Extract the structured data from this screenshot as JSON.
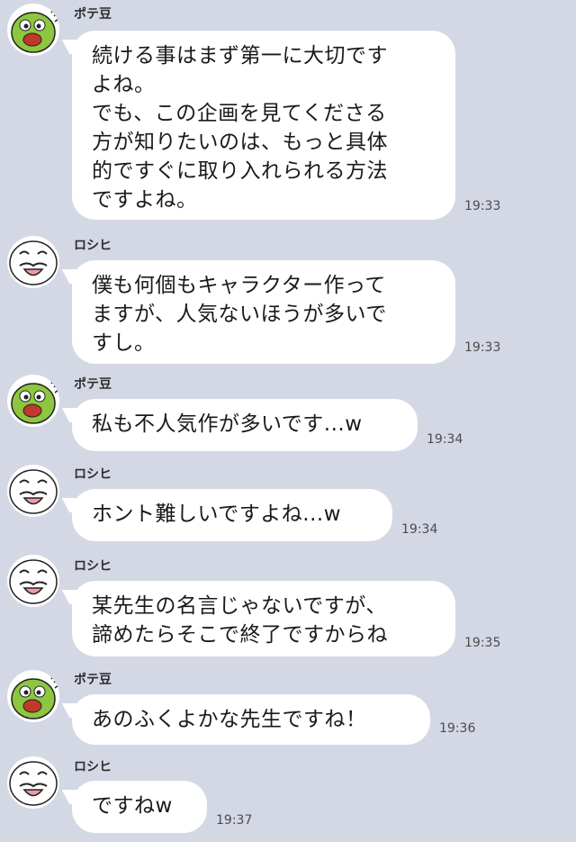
{
  "messages": [
    {
      "sender": "ポテ豆",
      "avatar": "potemame-avatar-icon",
      "text": "続ける事はまず第一に大切です\nよね。\nでも、この企画を見てくださる\n方が知りたいのは、もっと具体\n的ですぐに取り入れられる方法\nですよね。",
      "time": "19:33"
    },
    {
      "sender": "ロシヒ",
      "avatar": "roshihi-avatar-icon",
      "text": "僕も何個もキャラクター作って\nますが、人気ないほうが多いで\nすし。",
      "time": "19:33"
    },
    {
      "sender": "ポテ豆",
      "avatar": "potemame-avatar-icon",
      "text": "私も不人気作が多いです...w",
      "time": "19:34"
    },
    {
      "sender": "ロシヒ",
      "avatar": "roshihi-avatar-icon",
      "text": "ホント難しいですよね...w",
      "time": "19:34"
    },
    {
      "sender": "ロシヒ",
      "avatar": "roshihi-avatar-icon",
      "text": "某先生の名言じゃないですが、\n諦めたらそこで終了ですからね",
      "time": "19:35"
    },
    {
      "sender": "ポテ豆",
      "avatar": "potemame-avatar-icon",
      "text": "あのふくよかな先生ですね！",
      "time": "19:36"
    },
    {
      "sender": "ロシヒ",
      "avatar": "roshihi-avatar-icon",
      "text": "ですねw",
      "time": "19:37"
    }
  ]
}
